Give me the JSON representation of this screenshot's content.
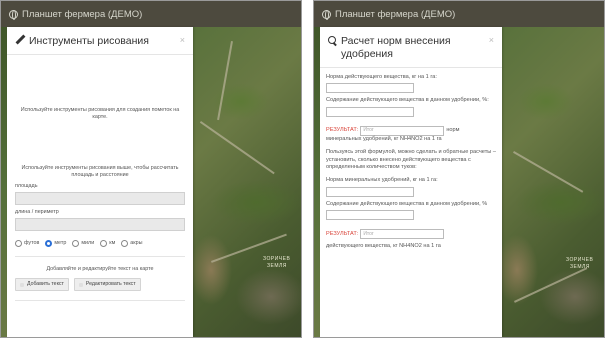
{
  "app": {
    "title": "Планшет фермера (ДЕМО)"
  },
  "left_panel": {
    "title": "Инструменты рисования",
    "close": "×",
    "hint_markers": "Используйте инструменты рисования для создания пометок на карте.",
    "hint_measure": "Используйте инструменты рисования выше, чтобы рассчитать площадь и расстояние",
    "area_label": "площадь",
    "perimeter_label": "длина / периметр",
    "units": [
      {
        "label": "футов",
        "selected": false
      },
      {
        "label": "метр",
        "selected": true
      },
      {
        "label": "мили",
        "selected": false
      },
      {
        "label": "км",
        "selected": false
      },
      {
        "label": "акры",
        "selected": false
      }
    ],
    "text_hint": "Добавляйте и редактируйте текст на карте",
    "add_text_button": "Добавить текст",
    "edit_text_button": "Редактировать текст"
  },
  "right_panel": {
    "title": "Расчет норм внесения удобрения",
    "close": "×",
    "active_label": "Норма действующего вещества, кг на 1 га:",
    "content_label_1": "Содержание действующего вещества в данном удобрении, %:",
    "result_prefix": "РЕЗУЛЬТАТ:",
    "result_placeholder": "Итог",
    "result_suffix_1": "норм",
    "result_line_1": "минеральных удобрений, кг NH4NO2 на 1 га",
    "reverse_hint": "Пользуясь этой формулой, можно сделать и обратные расчеты – установить, сколько внесено действующего вещества с определенным количеством туков:",
    "mineral_label": "Норма минеральных удобрений, кг на 1 га:",
    "content_label_2": "Содержание действующего вещества в данном удобрении, %",
    "result_line_2": "действующего вещества, кг NH4NO2 на 1 га"
  },
  "colors": {
    "titlebar": "#4d4a3e",
    "result": "#d9443a",
    "selected_radio": "#2a6fd6"
  }
}
